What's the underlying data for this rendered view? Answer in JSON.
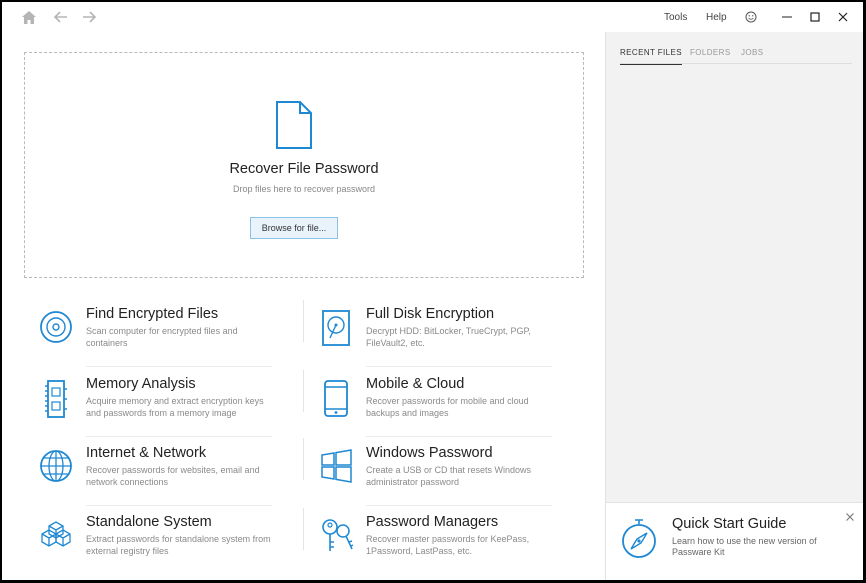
{
  "titlebar": {
    "tools_label": "Tools",
    "help_label": "Help"
  },
  "dropzone": {
    "title": "Recover File Password",
    "subtitle": "Drop files here to recover password",
    "browse_label": "Browse for file..."
  },
  "features": [
    {
      "title": "Find Encrypted Files",
      "desc": "Scan computer for encrypted files and containers",
      "icon": "disc-search-icon"
    },
    {
      "title": "Full Disk Encryption",
      "desc": "Decrypt HDD: BitLocker, TrueCrypt, PGP, FileVault2, etc.",
      "icon": "hard-drive-icon"
    },
    {
      "title": "Memory Analysis",
      "desc": "Acquire memory and extract encryption keys and passwords from a memory image",
      "icon": "memory-module-icon"
    },
    {
      "title": "Mobile & Cloud",
      "desc": "Recover passwords for mobile and cloud backups and images",
      "icon": "mobile-phone-icon"
    },
    {
      "title": "Internet & Network",
      "desc": "Recover passwords for websites, email and network connections",
      "icon": "globe-icon"
    },
    {
      "title": "Windows Password",
      "desc": "Create a USB or CD that resets Windows administrator password",
      "icon": "windows-logo-icon"
    },
    {
      "title": "Standalone System",
      "desc": "Extract passwords for standalone system from external registry files",
      "icon": "cubes-icon"
    },
    {
      "title": "Password Managers",
      "desc": "Recover master passwords for KeePass, 1Password, LastPass, etc.",
      "icon": "keys-icon"
    }
  ],
  "sidebar": {
    "tabs": [
      "RECENT FILES",
      "FOLDERS",
      "JOBS"
    ],
    "active_tab": "RECENT FILES",
    "quick_start": {
      "title": "Quick Start Guide",
      "desc": "Learn how to use the new version of Passware Kit"
    }
  },
  "colors": {
    "accent": "#1e88d2",
    "sidebar_bg": "#f2f2f2"
  }
}
